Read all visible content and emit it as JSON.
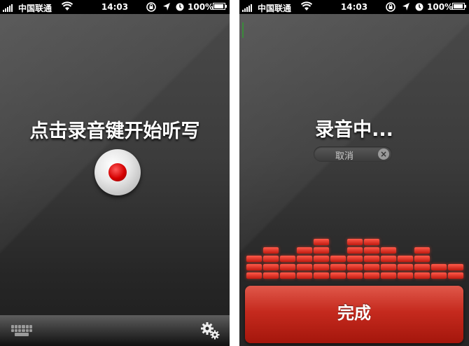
{
  "status_bar": {
    "carrier": "中国联通",
    "time": "14:03",
    "battery": "100%"
  },
  "left_screen": {
    "prompt": "点击录音键开始听写",
    "record_button": {
      "icon": "record-dot-icon",
      "color": "#d40000"
    },
    "toolbar": {
      "keyboard_icon": "keyboard-icon",
      "settings_icon": "gears-icon"
    }
  },
  "right_screen": {
    "status_text": "录音中...",
    "cancel_label": "取消",
    "done_label": "完成",
    "accent_color": "#c52a1e",
    "equalizer_levels": [
      3,
      4,
      3,
      4,
      5,
      3,
      5,
      5,
      4,
      3,
      4,
      2,
      2
    ]
  }
}
